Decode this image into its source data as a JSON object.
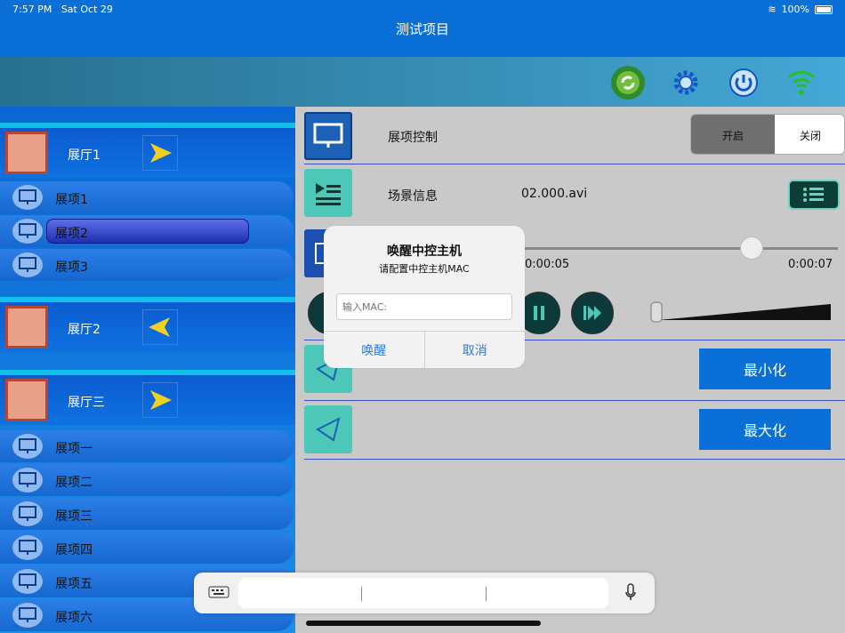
{
  "status_bar": {
    "time": "7:57 PM",
    "date": "Sat Oct 29",
    "battery": "100%"
  },
  "header": {
    "title": "测试项目"
  },
  "toolbar": {
    "icons": [
      "refresh-icon",
      "gear-icon",
      "power-icon",
      "wifi-icon"
    ]
  },
  "halls": [
    {
      "label": "展厅1",
      "arrow": "right",
      "items": [
        {
          "label": "展项1"
        },
        {
          "label": "展项2",
          "selected": true
        },
        {
          "label": "展项3"
        }
      ]
    },
    {
      "label": "展厅2",
      "arrow": "left",
      "items": []
    },
    {
      "label": "展厅三",
      "arrow": "right",
      "items": [
        {
          "label": "展项一"
        },
        {
          "label": "展项二"
        },
        {
          "label": "展项三"
        },
        {
          "label": "展项四"
        },
        {
          "label": "展项五"
        },
        {
          "label": "展项六"
        }
      ]
    }
  ],
  "control": {
    "exhibit_label": "展项控制",
    "on_label": "开启",
    "off_label": "关闭",
    "scene_label": "场景信息",
    "scene_file": "02.000.avi",
    "time_current": "0:00:05",
    "time_total": "0:00:07",
    "minimize_label": "最小化",
    "maximize_label": "最大化"
  },
  "dialog": {
    "title": "唤醒中控主机",
    "message": "请配置中控主机MAC",
    "input_placeholder": "输入MAC:",
    "confirm_label": "唤醒",
    "cancel_label": "取消"
  },
  "colors": {
    "primary": "#0a6fd6",
    "accent": "#2a7de1"
  }
}
